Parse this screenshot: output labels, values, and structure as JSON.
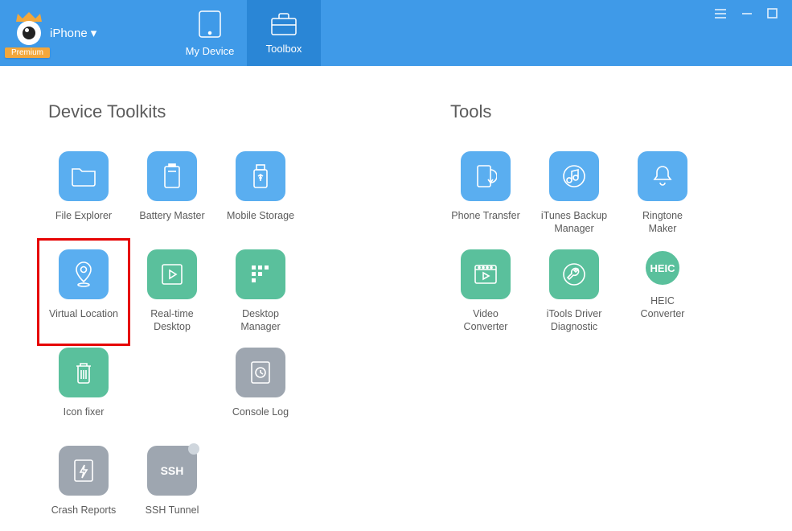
{
  "header": {
    "premium_label": "Premium",
    "device_label": "iPhone",
    "nav": {
      "my_device": "My Device",
      "toolbox": "Toolbox"
    }
  },
  "sections": {
    "device_toolkits_title": "Device Toolkits",
    "tools_title": "Tools"
  },
  "device_toolkits": {
    "file_explorer": "File Explorer",
    "battery_master": "Battery Master",
    "mobile_storage": "Mobile Storage",
    "virtual_location": "Virtual Location",
    "realtime_desktop": "Real-time Desktop",
    "desktop_manager": "Desktop Manager",
    "icon_fixer": "Icon fixer",
    "console_log": "Console Log",
    "crash_reports": "Crash Reports",
    "ssh_tunnel": "SSH Tunnel"
  },
  "tools": {
    "phone_transfer": "Phone Transfer",
    "itunes_backup": "iTunes Backup Manager",
    "ringtone_maker": "Ringtone Maker",
    "video_converter": "Video Converter",
    "driver_diagnostic": "iTools Driver Diagnostic",
    "heic_converter": "HEIC Converter",
    "heic_badge": "HEIC",
    "ssh_badge": "SSH"
  },
  "colors": {
    "header": "#3f9ae8",
    "header_active": "#2a86d6",
    "blue_tile": "#5aaef0",
    "green_tile": "#5ac09c",
    "gray_tile": "#9ea6b0",
    "highlight": "#e60000"
  }
}
